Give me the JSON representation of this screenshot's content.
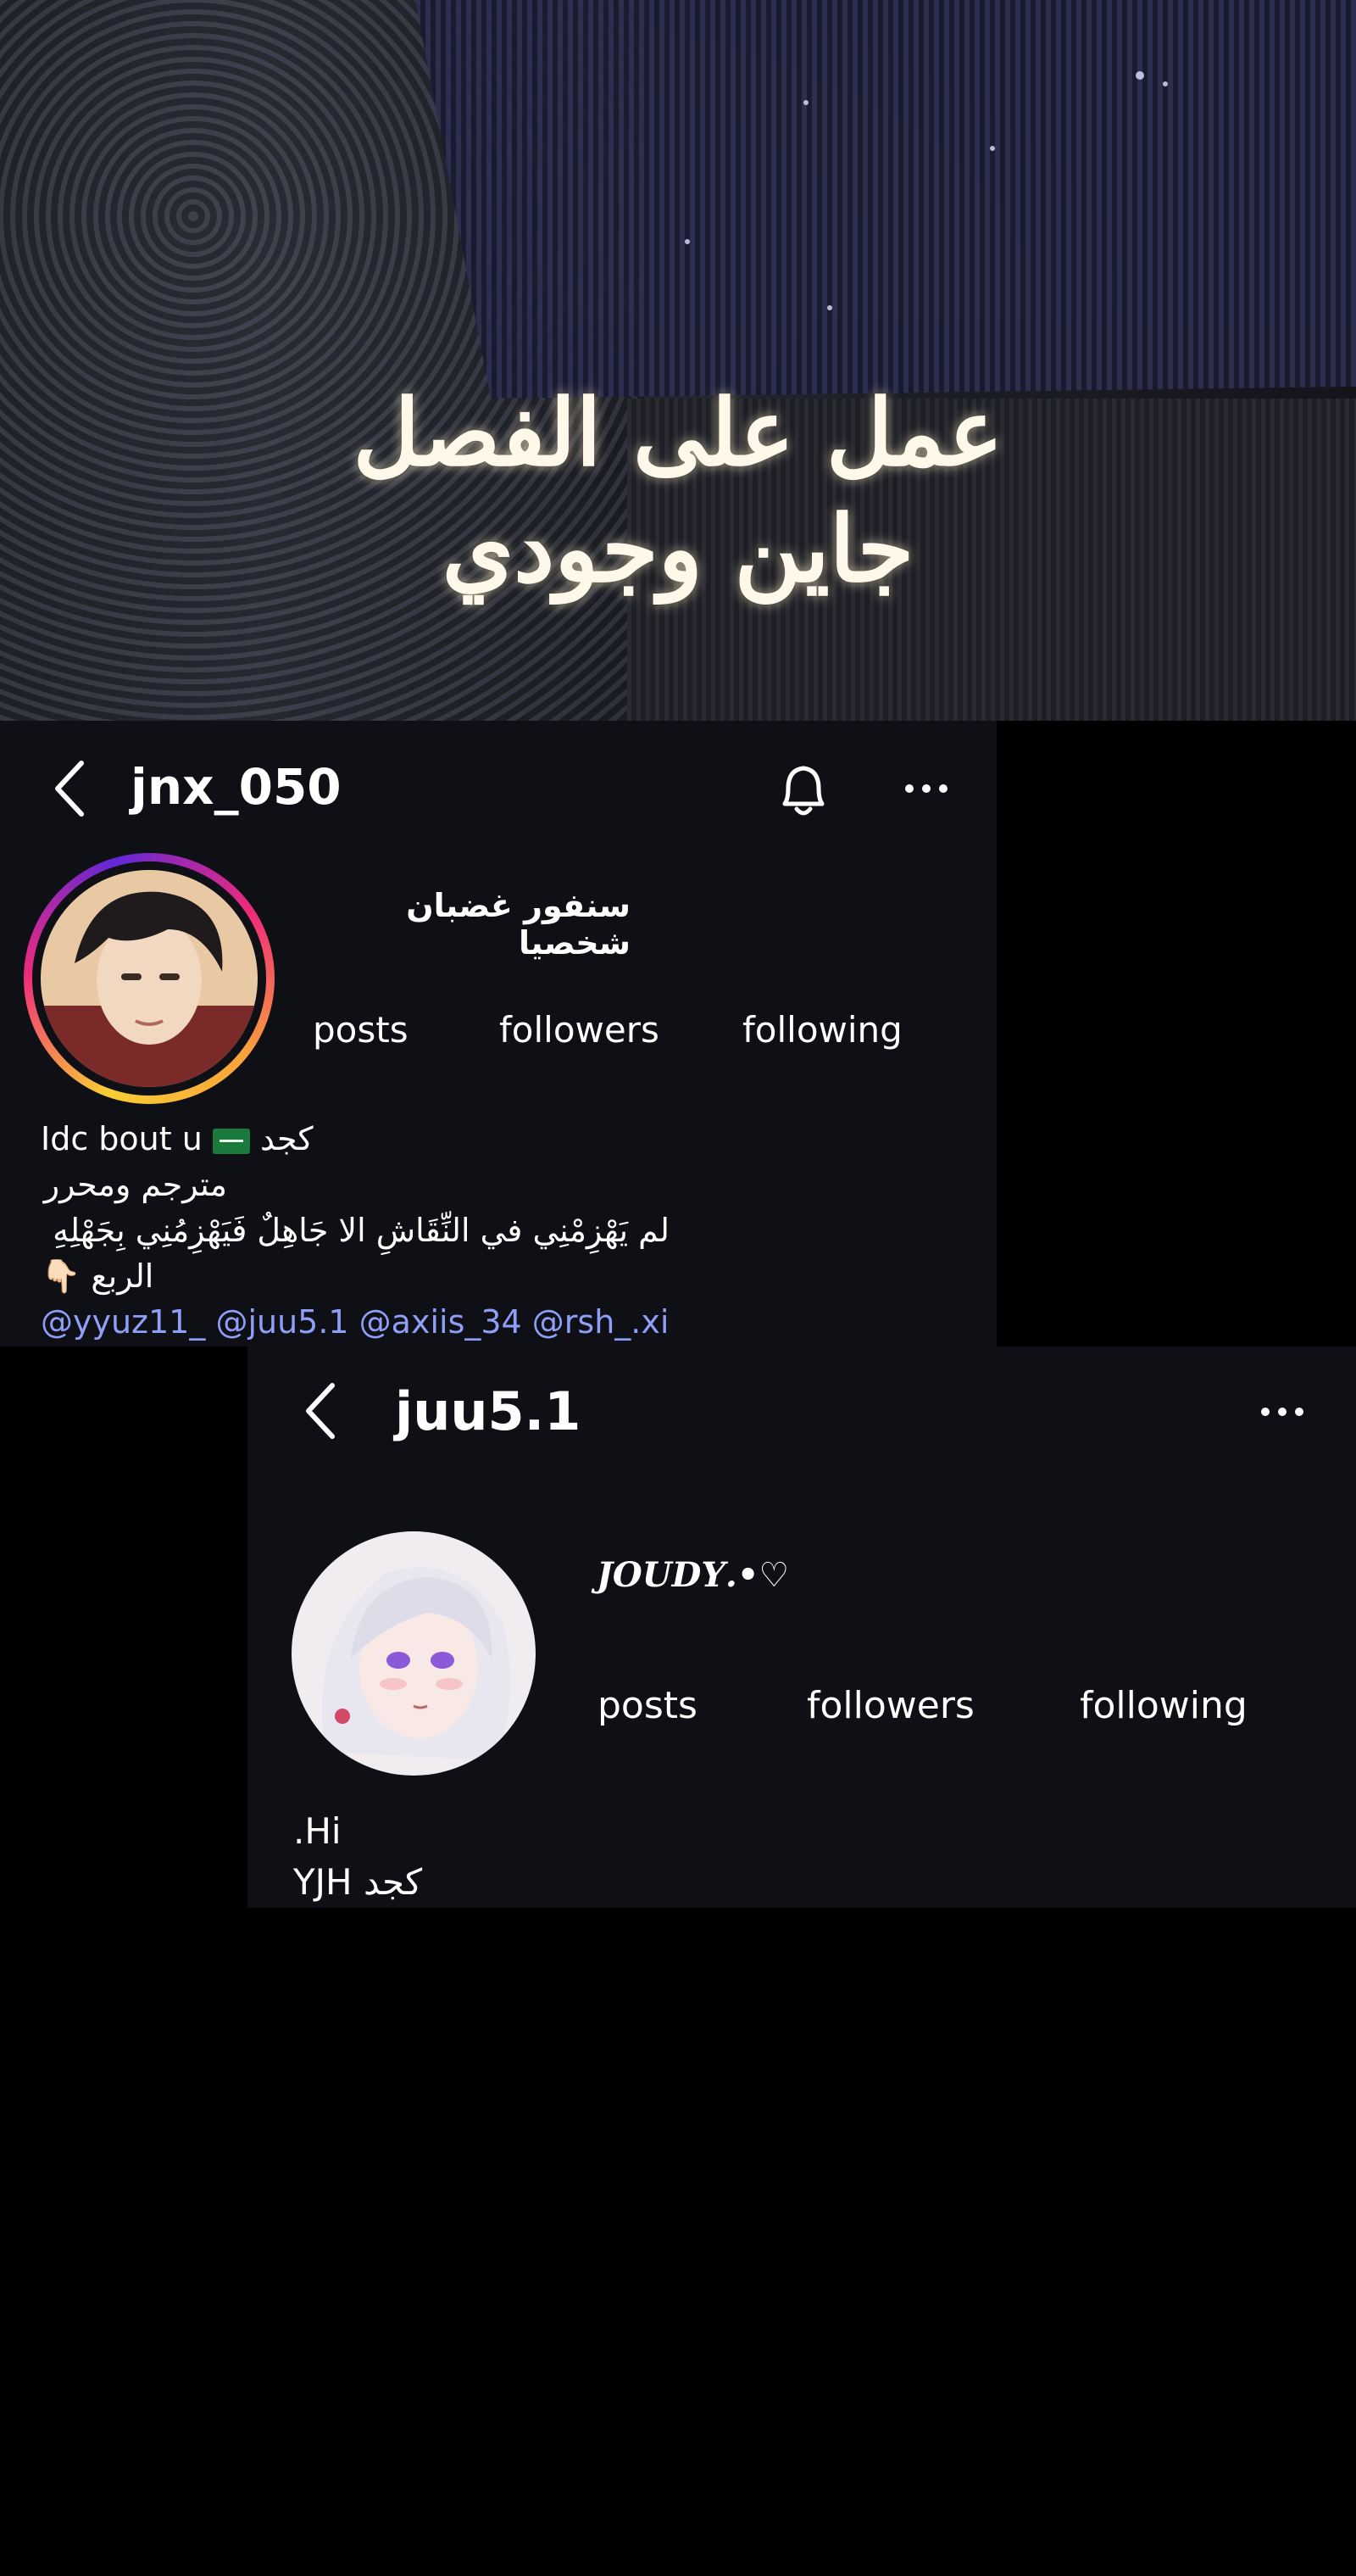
{
  "banner": {
    "line1": "عمل على الفصل",
    "line2": "جاين وجودي"
  },
  "profile1": {
    "username": "jnx_050",
    "display_name": "سنفور غضبان شخصيا",
    "stats": {
      "posts": "posts",
      "followers": "followers",
      "following": "following"
    },
    "bio_line1": "Idc bout u",
    "bio_line1_tail": "كجد",
    "bio_line2": "مترجم ومحرر",
    "bio_line3": "لم يَهْزِمْنِي في النِّقَاشِ الا جَاهِلٌ فَيَهْزِمُنِي بِجَهْلِهِ",
    "bio_line4": "الربع",
    "mentions": "@yyuz11_ @juu5.1 @axiis_34 @rsh_.xi",
    "icons": {
      "back": "chevron-left-icon",
      "bell": "bell-icon",
      "more": "more-horizontal-icon",
      "flag": "saudi-flag-icon",
      "hand": "pointing-down-hand-icon"
    }
  },
  "profile2": {
    "username": "juu5.1",
    "display_name": "𝑱𝑶𝑼𝑫𝒀.•♡",
    "stats": {
      "posts": "posts",
      "followers": "followers",
      "following": "following"
    },
    "bio_line1": ".Hi",
    "bio_line2": "YJH كجد",
    "icons": {
      "back": "chevron-left-icon",
      "more": "more-horizontal-icon"
    }
  },
  "colors": {
    "panel_bg": "#0e1016",
    "mention": "#8f9ef6",
    "ring_start": "#f9ce34",
    "ring_mid": "#ee2a7b"
  }
}
